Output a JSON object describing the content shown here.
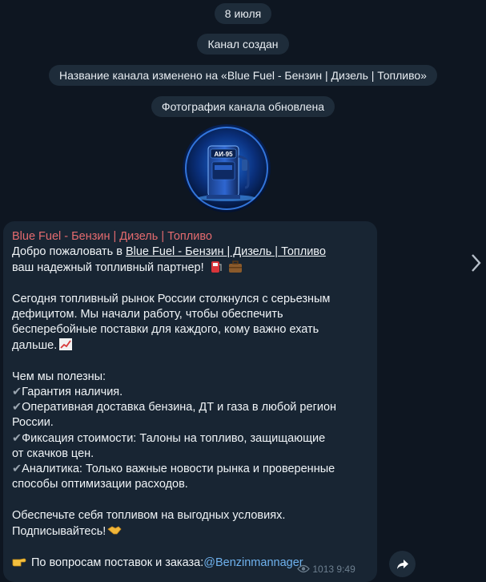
{
  "service_messages": {
    "date": "8 июля",
    "created": "Канал создан",
    "renamed": "Название канала изменено на «Blue Fuel - Бензин | Дизель | Топливо»",
    "photo_updated": "Фотография канала обновлена"
  },
  "avatar": {
    "pump_label": "АИ-95"
  },
  "post": {
    "author": "Blue Fuel - Бензин | Дизель | Топливо",
    "welcome_prefix": "Добро пожаловать в ",
    "welcome_link": "Blue Fuel - Бензин | Дизель | Топливо",
    "welcome_suffix": "ваш надежный топливный партнер!",
    "p1_l1": "Сегодня топливный рынок России столкнулся с серьезным",
    "p1_l2": "дефицитом. Мы начали работу, чтобы обеспечить",
    "p1_l3": "бесперебойные поставки для каждого, кому важно ехать",
    "p1_l4": "дальше.",
    "useful_title": "Чем мы полезны:",
    "b1": "Гарантия наличия.",
    "b2_l1": "Оперативная доставка бензина, ДТ и газа в любой регион",
    "b2_l2": "России.",
    "b3_l1": "Фиксация стоимости: Талоны на топливо, защищающие",
    "b3_l2": "от скачков цен.",
    "b4_l1": "Аналитика: Только важные новости рынка и проверенные",
    "b4_l2": "способы оптимизации расходов.",
    "cta_l1": "Обеспечьте себя топливом на выгодных условиях.",
    "cta_l2": "Подписывайтесь!",
    "contact_prefix": "По вопросам поставок и заказа:",
    "contact_handle": "@Benzinmannager",
    "views": "1013",
    "time": "9:49"
  },
  "icons": {
    "check": "heavy-check-mark-icon",
    "pump": "fuel-pump-icon",
    "briefcase": "briefcase-icon",
    "chart": "chart-increasing-icon",
    "handshake": "handshake-icon",
    "point": "backhand-index-pointing-right-icon",
    "eye": "eye-icon",
    "share": "share-arrow-icon"
  },
  "colors": {
    "background": "#0e1621",
    "bubble": "#182533",
    "author": "#e56b6f",
    "link": "#6fb2ee"
  }
}
